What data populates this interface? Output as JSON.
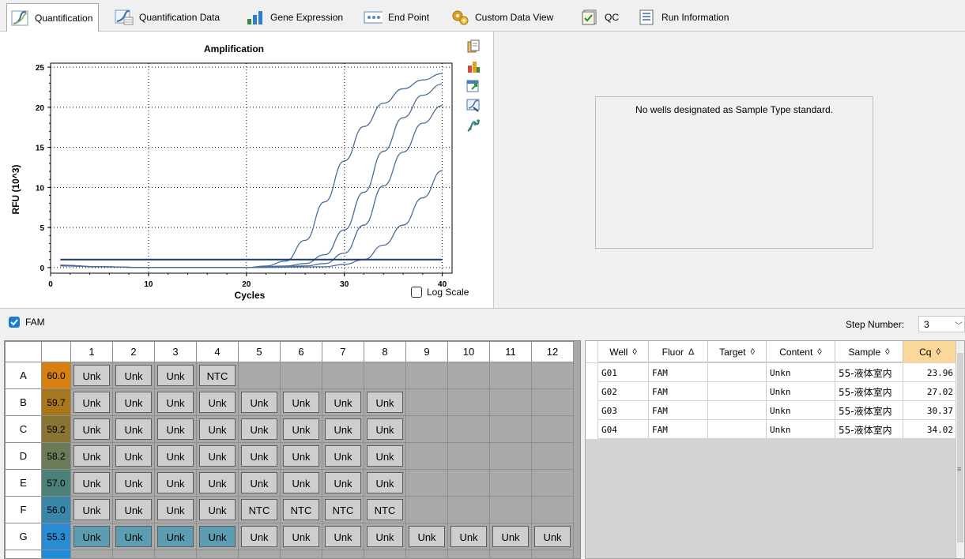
{
  "tabs": [
    {
      "label": "Quantification",
      "icon": "quantification-icon",
      "active": true
    },
    {
      "label": "Quantification Data",
      "icon": "quantification-data-icon",
      "active": false
    },
    {
      "label": "Gene Expression",
      "icon": "gene-expression-icon",
      "active": false
    },
    {
      "label": "End Point",
      "icon": "end-point-icon",
      "active": false
    },
    {
      "label": "Custom Data View",
      "icon": "custom-data-view-icon",
      "active": false
    },
    {
      "label": "QC",
      "icon": "qc-icon",
      "active": false
    },
    {
      "label": "Run Information",
      "icon": "run-information-icon",
      "active": false
    }
  ],
  "chart_data": {
    "type": "line",
    "title": "Amplification",
    "xlabel": "Cycles",
    "ylabel": "RFU (10^3)",
    "xlim": [
      0,
      41
    ],
    "ylim": [
      -0.7,
      25.5
    ],
    "xticks": [
      0,
      10,
      20,
      30,
      40
    ],
    "yticks": [
      0,
      5,
      10,
      15,
      20,
      25
    ],
    "grid": true,
    "threshold": 1.0,
    "series": [
      {
        "x": [
          1,
          5,
          10,
          15,
          20,
          22,
          24,
          26,
          28,
          30,
          32,
          34,
          36,
          38,
          40
        ],
        "y": [
          0.3,
          0.1,
          0.0,
          0.0,
          0.0,
          0.2,
          0.8,
          3.4,
          8.2,
          13.3,
          17.6,
          20.5,
          22.3,
          23.4,
          24.2
        ]
      },
      {
        "x": [
          1,
          5,
          10,
          15,
          20,
          24,
          26,
          28,
          30,
          32,
          34,
          36,
          38,
          40
        ],
        "y": [
          0.3,
          0.1,
          0.0,
          0.0,
          0.0,
          0.2,
          0.5,
          1.6,
          4.7,
          9.4,
          14.5,
          18.7,
          21.5,
          22.9
        ]
      },
      {
        "x": [
          1,
          5,
          10,
          15,
          20,
          26,
          28,
          30,
          32,
          34,
          36,
          38,
          40
        ],
        "y": [
          0.3,
          0.1,
          0.0,
          0.0,
          0.0,
          0.2,
          0.5,
          1.8,
          5.3,
          10.2,
          14.4,
          18.0,
          20.2
        ]
      },
      {
        "x": [
          1,
          5,
          10,
          15,
          20,
          28,
          30,
          32,
          34,
          36,
          38,
          40
        ],
        "y": [
          0.2,
          0.1,
          0.0,
          0.0,
          0.0,
          0.1,
          0.4,
          1.0,
          2.8,
          5.3,
          8.7,
          12.1
        ]
      }
    ],
    "log_scale": false,
    "series_color": "#4a6d9a",
    "threshold_color": "#1a3a7a"
  },
  "chart_toolbar": [
    "copy-icon",
    "chart-color-icon",
    "export-icon",
    "zoom-chart-icon",
    "curve-settings-icon"
  ],
  "log_scale_label": "Log Scale",
  "standard_curve": {
    "message": "No wells designated as Sample Type standard."
  },
  "fluor": {
    "label": "FAM",
    "checked": true
  },
  "step": {
    "label": "Step Number:",
    "value": "3"
  },
  "plate": {
    "columns": [
      "1",
      "2",
      "3",
      "4",
      "5",
      "6",
      "7",
      "8",
      "9",
      "10",
      "11",
      "12"
    ],
    "rows": [
      {
        "row": "A",
        "temp": "60.0",
        "temp_color": "#d77f10",
        "wells": [
          "Unk",
          "Unk",
          "Unk",
          "NTC",
          "",
          "",
          "",
          "",
          "",
          "",
          "",
          ""
        ]
      },
      {
        "row": "B",
        "temp": "59.7",
        "temp_color": "#a8761d",
        "wells": [
          "Unk",
          "Unk",
          "Unk",
          "Unk",
          "Unk",
          "Unk",
          "Unk",
          "Unk",
          "",
          "",
          "",
          ""
        ]
      },
      {
        "row": "C",
        "temp": "59.2",
        "temp_color": "#8a7434",
        "wells": [
          "Unk",
          "Unk",
          "Unk",
          "Unk",
          "Unk",
          "Unk",
          "Unk",
          "Unk",
          "",
          "",
          "",
          ""
        ]
      },
      {
        "row": "D",
        "temp": "58.2",
        "temp_color": "#6c7a58",
        "wells": [
          "Unk",
          "Unk",
          "Unk",
          "Unk",
          "Unk",
          "Unk",
          "Unk",
          "Unk",
          "",
          "",
          "",
          ""
        ]
      },
      {
        "row": "E",
        "temp": "57.0",
        "temp_color": "#4c8078",
        "wells": [
          "Unk",
          "Unk",
          "Unk",
          "Unk",
          "Unk",
          "Unk",
          "Unk",
          "Unk",
          "",
          "",
          "",
          ""
        ]
      },
      {
        "row": "F",
        "temp": "56.0",
        "temp_color": "#3a86a8",
        "wells": [
          "Unk",
          "Unk",
          "Unk",
          "Unk",
          "NTC",
          "NTC",
          "NTC",
          "NTC",
          "",
          "",
          "",
          ""
        ]
      },
      {
        "row": "G",
        "temp": "55.3",
        "temp_color": "#2a8bd0",
        "wells": [
          "Unk",
          "Unk",
          "Unk",
          "Unk",
          "Unk",
          "Unk",
          "Unk",
          "Unk",
          "Unk",
          "Unk",
          "Unk",
          "Unk"
        ]
      },
      {
        "row": "",
        "temp": "",
        "temp_color": "#1a8ce0",
        "wells": [
          "",
          "",
          "",
          "",
          "",
          "",
          "",
          "",
          "",
          "",
          "",
          ""
        ]
      }
    ]
  },
  "well_table": {
    "headers": [
      {
        "label": "Well",
        "sort": "◊"
      },
      {
        "label": "Fluor",
        "sort": "Δ"
      },
      {
        "label": "Target",
        "sort": "◊"
      },
      {
        "label": "Content",
        "sort": "◊"
      },
      {
        "label": "Sample",
        "sort": "◊"
      },
      {
        "label": "Cq",
        "sort": "◊"
      }
    ],
    "rows": [
      {
        "well": "G01",
        "fluor": "FAM",
        "target": "",
        "content": "Unkn",
        "sample": "55-液体室内",
        "cq": "23.96"
      },
      {
        "well": "G02",
        "fluor": "FAM",
        "target": "",
        "content": "Unkn",
        "sample": "55-液体室内",
        "cq": "27.02"
      },
      {
        "well": "G03",
        "fluor": "FAM",
        "target": "",
        "content": "Unkn",
        "sample": "55-液体室内",
        "cq": "30.37"
      },
      {
        "well": "G04",
        "fluor": "FAM",
        "target": "",
        "content": "Unkn",
        "sample": "55-液体室内",
        "cq": "34.02"
      }
    ]
  }
}
